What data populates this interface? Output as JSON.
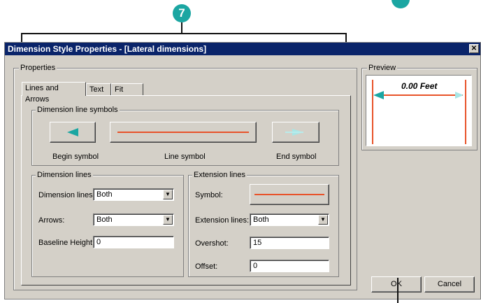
{
  "callouts": {
    "step_number": "7"
  },
  "dialog": {
    "title": "Dimension Style Properties - [Lateral dimensions]",
    "close_glyph": "✕",
    "properties_group": "Properties",
    "preview_group": "Preview",
    "preview_value": "0.00 Feet",
    "tabs": [
      {
        "label": "Lines and Arrows",
        "active": true
      },
      {
        "label": "Text",
        "active": false
      },
      {
        "label": "Fit",
        "active": false
      }
    ],
    "dimension_line_symbols": {
      "group": "Dimension line symbols",
      "begin_label": "Begin symbol",
      "line_label": "Line symbol",
      "end_label": "End symbol"
    },
    "dimension_lines": {
      "group": "Dimension lines",
      "dimension_lines_label": "Dimension lines:",
      "dimension_lines_value": "Both",
      "arrows_label": "Arrows:",
      "arrows_value": "Both",
      "baseline_label": "Baseline Height:",
      "baseline_value": "0"
    },
    "extension_lines": {
      "group": "Extension lines",
      "symbol_label": "Symbol:",
      "extension_lines_label": "Extension lines:",
      "extension_lines_value": "Both",
      "overshot_label": "Overshot:",
      "overshot_value": "15",
      "offset_label": "Offset:",
      "offset_value": "0"
    },
    "ok_label": "OK",
    "cancel_label": "Cancel"
  },
  "colors": {
    "accent": "#1ba6a2",
    "line": "#e8532a",
    "title_bar": "#0a246a",
    "face": "#d4d0c8"
  }
}
